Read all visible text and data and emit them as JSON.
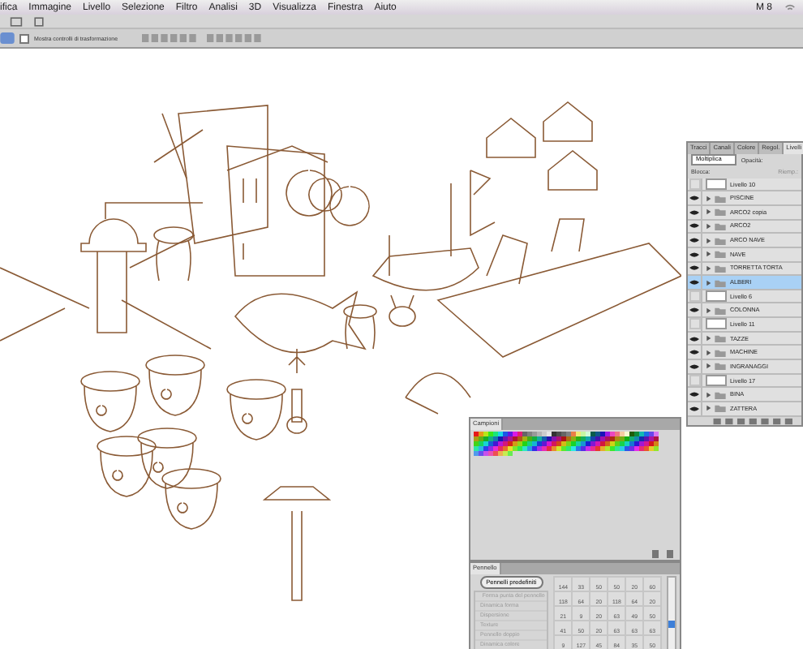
{
  "menu_bar": {
    "items": [
      "ifica",
      "Immagine",
      "Livello",
      "Selezione",
      "Filtro",
      "Analisi",
      "3D",
      "Visualizza",
      "Finestra",
      "Aiuto"
    ],
    "status": "M 8"
  },
  "options_bar": {
    "checkbox": {
      "label": "Mostra controlli di trasformazione",
      "checked": false
    }
  },
  "layers_panel": {
    "tabs": [
      {
        "label": "Tracci",
        "selected": false
      },
      {
        "label": "Canali",
        "selected": false
      },
      {
        "label": "Colore",
        "selected": false
      },
      {
        "label": "Regol.",
        "selected": false
      },
      {
        "label": "Livelli",
        "selected": true
      }
    ],
    "blend_mode": "Moltiplica",
    "opacity_label": "Opacità:",
    "lock_label": "Blocca:",
    "fill_label": "Riemp.:",
    "layers": [
      {
        "name": "Livello 10",
        "kind": "layer",
        "visible": false,
        "selected": false
      },
      {
        "name": "PISCINE",
        "kind": "folder",
        "visible": true,
        "selected": false
      },
      {
        "name": "ARCO2 copia",
        "kind": "folder",
        "visible": true,
        "selected": false
      },
      {
        "name": "ARCO2",
        "kind": "folder",
        "visible": true,
        "selected": false
      },
      {
        "name": "ARCO NAVE",
        "kind": "folder",
        "visible": true,
        "selected": false
      },
      {
        "name": "NAVE",
        "kind": "folder",
        "visible": true,
        "selected": false
      },
      {
        "name": "TORRETTA TORTA",
        "kind": "folder",
        "visible": true,
        "selected": false
      },
      {
        "name": "ALBERI",
        "kind": "folder",
        "visible": true,
        "selected": true
      },
      {
        "name": "Livello 6",
        "kind": "layer",
        "visible": false,
        "selected": false
      },
      {
        "name": "COLONNA",
        "kind": "folder",
        "visible": true,
        "selected": false
      },
      {
        "name": "Livello 11",
        "kind": "layer",
        "visible": false,
        "selected": false
      },
      {
        "name": "TAZZE",
        "kind": "folder",
        "visible": true,
        "selected": false
      },
      {
        "name": "MACHINE",
        "kind": "folder",
        "visible": true,
        "selected": false
      },
      {
        "name": "INGRANAGGI",
        "kind": "folder",
        "visible": true,
        "selected": false
      },
      {
        "name": "Livello 17",
        "kind": "layer",
        "visible": false,
        "selected": false
      },
      {
        "name": "BINA",
        "kind": "folder",
        "visible": true,
        "selected": false
      },
      {
        "name": "ZATTERA",
        "kind": "folder",
        "visible": true,
        "selected": false
      }
    ]
  },
  "swatches_panel": {
    "tab": "Campioni"
  },
  "brush_panel": {
    "tab": "Pennello",
    "preset_button": "Pennelli predefiniti",
    "options": [
      {
        "label": "Forma punta del pennello",
        "kind": "header"
      },
      {
        "label": "Dinamica forma",
        "kind": "check"
      },
      {
        "label": "Dispersione",
        "kind": "check"
      },
      {
        "label": "Texture",
        "kind": "check"
      },
      {
        "label": "Pennello doppio",
        "kind": "check"
      },
      {
        "label": "Dinamica colore",
        "kind": "check"
      }
    ],
    "tip_sizes": [
      "144",
      "33",
      "50",
      "50",
      "20",
      "60",
      "118",
      "64",
      "20",
      "118",
      "64",
      "20",
      "21",
      "9",
      "20",
      "63",
      "49",
      "50",
      "41",
      "50",
      "20",
      "63",
      "63",
      "63",
      "9",
      "127",
      "45",
      "84",
      "35",
      "50"
    ]
  }
}
